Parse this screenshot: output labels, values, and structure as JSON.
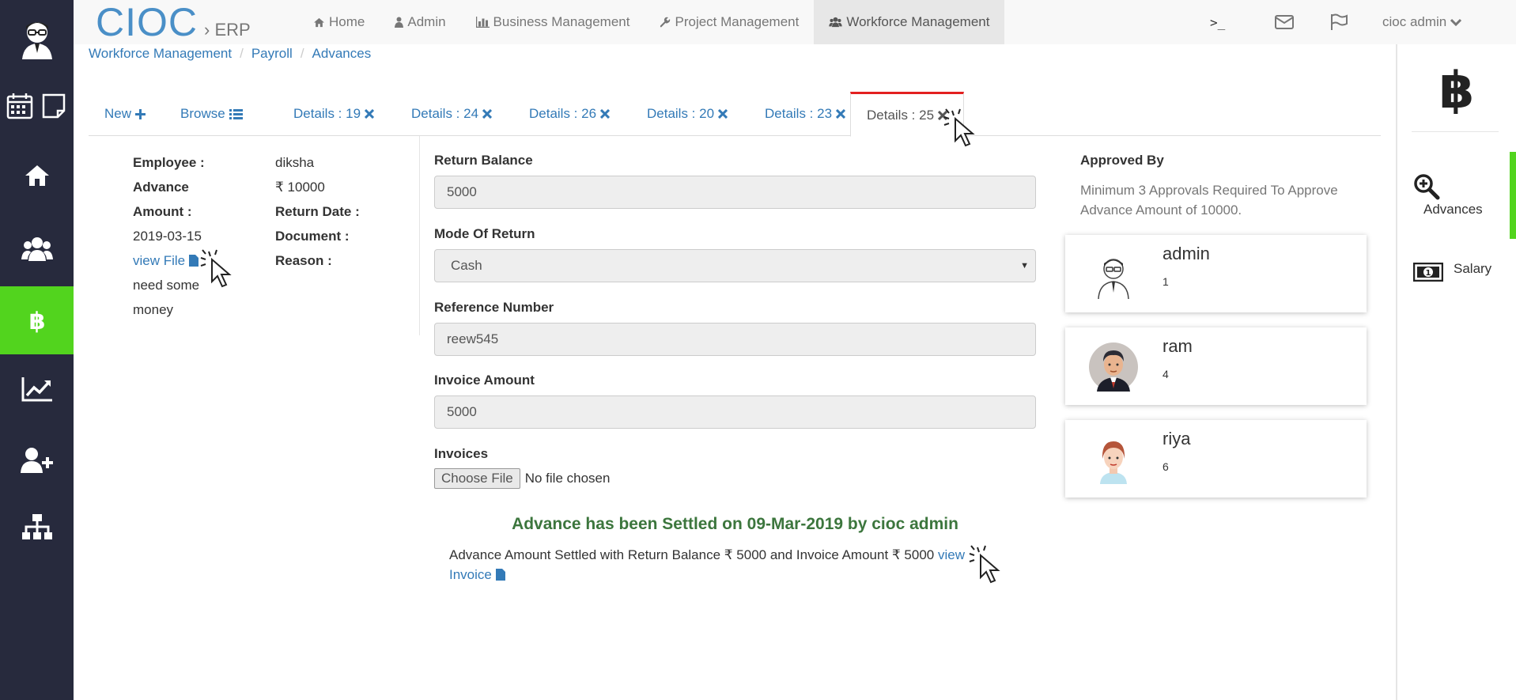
{
  "brand": {
    "name": "CIOC",
    "sub": "ERP"
  },
  "nav": {
    "items": [
      {
        "label": "Home",
        "icon": "home-icon"
      },
      {
        "label": "Admin",
        "icon": "user-icon"
      },
      {
        "label": "Business Management",
        "icon": "bar-chart-icon"
      },
      {
        "label": "Project Management",
        "icon": "wrench-icon"
      },
      {
        "label": "Workforce Management",
        "icon": "users-icon",
        "active": true
      }
    ],
    "terminal": ">_",
    "user": "cioc admin"
  },
  "sidebar": {
    "items": [
      "avatar",
      "calendar-icon",
      "note-icon",
      "home-icon",
      "users-icon",
      "bitcoin-icon",
      "chart-line-icon",
      "user-plus-icon",
      "sitemap-icon"
    ],
    "active": "bitcoin-icon"
  },
  "breadcrumb": [
    "Workforce Management",
    "Payroll",
    "Advances"
  ],
  "tabs": [
    {
      "label": "New",
      "icon": "plus-icon"
    },
    {
      "label": "Browse",
      "icon": "list-icon"
    },
    {
      "label": "Details : 19",
      "icon": "close-icon"
    },
    {
      "label": "Details : 24",
      "icon": "close-icon"
    },
    {
      "label": "Details : 26",
      "icon": "close-icon"
    },
    {
      "label": "Details : 20",
      "icon": "close-icon"
    },
    {
      "label": "Details : 23",
      "icon": "close-icon"
    },
    {
      "label": "Details : 25",
      "icon": "close-icon",
      "active": true
    }
  ],
  "details": {
    "employee_label": "Employee :",
    "employee": "diksha",
    "advance_label": "Advance",
    "amount_label": "Amount :",
    "amount": "₹ 10000",
    "return_date_label": "Return Date :",
    "return_date": "2019-03-15",
    "document_label": "Document :",
    "view_file": "view File",
    "reason_label": "Reason :",
    "reason_line1": "need some",
    "reason_line2": "money"
  },
  "form": {
    "return_balance_label": "Return Balance",
    "return_balance": "5000",
    "mode_label": "Mode Of Return",
    "mode": "Cash",
    "reference_label": "Reference Number",
    "reference": "reew545",
    "invoice_amount_label": "Invoice Amount",
    "invoice_amount": "5000",
    "invoices_label": "Invoices",
    "choose_file": "Choose File",
    "no_file": "No file chosen"
  },
  "settlement": {
    "title": "Advance has been Settled on 09-Mar-2019 by cioc admin",
    "desc": "Advance Amount Settled with Return Balance ₹ 5000 and Invoice Amount ₹ 5000",
    "link_part1": "view",
    "link_part2": "Invoice"
  },
  "approvals": {
    "title": "Approved By",
    "note": "Minimum 3 Approvals Required To Approve Advance Amount of 10000.",
    "approvers": [
      {
        "name": "admin",
        "count": "1"
      },
      {
        "name": "ram",
        "count": "4"
      },
      {
        "name": "riya",
        "count": "6"
      }
    ]
  },
  "rightpanel": {
    "items": [
      {
        "label": "Advances",
        "icon": "search-plus-icon"
      },
      {
        "label": "Salary",
        "icon": "money-icon"
      }
    ]
  },
  "colors": {
    "sidebar_bg": "#272a3d",
    "accent_green": "#52d41e",
    "link_blue": "#337ab7",
    "brand_blue": "#4a8fc7",
    "success_green": "#3c763d",
    "active_tab_top": "#e32020"
  }
}
